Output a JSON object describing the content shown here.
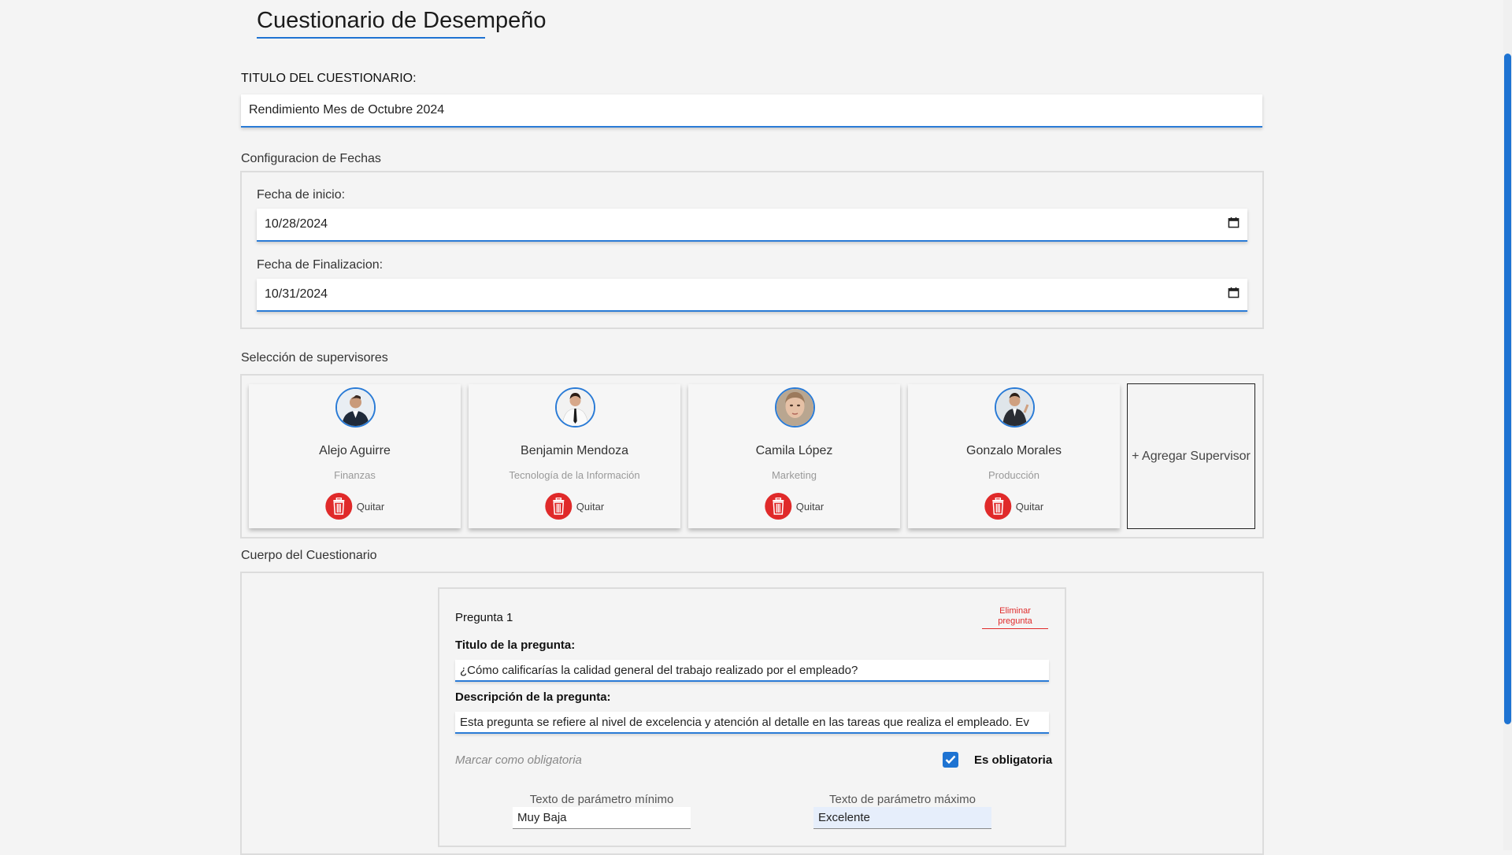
{
  "page": {
    "title": "Cuestionario de Desempeño"
  },
  "title_section": {
    "label": "TITULO DEL CUESTIONARIO:",
    "value": "Rendimiento Mes de Octubre 2024"
  },
  "dates": {
    "section_label": "Configuracion de Fechas",
    "start_label": "Fecha de inicio:",
    "start_value": "10/28/2024",
    "end_label": "Fecha de Finalizacion:",
    "end_value": "10/31/2024"
  },
  "supervisors": {
    "section_label": "Selección de supervisores",
    "remove_label": "Quitar",
    "add_label": "+ Agregar Supervisor",
    "items": [
      {
        "name": "Alejo Aguirre",
        "department": "Finanzas"
      },
      {
        "name": "Benjamin Mendoza",
        "department": "Tecnología de la Información"
      },
      {
        "name": "Camila López",
        "department": "Marketing"
      },
      {
        "name": "Gonzalo Morales",
        "department": "Producción"
      }
    ]
  },
  "questionnaire": {
    "section_label": "Cuerpo del Cuestionario",
    "question": {
      "number_label": "Pregunta 1",
      "delete_label": "Eliminar pregunta",
      "title_label": "Titulo de la pregunta:",
      "title_value": "¿Cómo calificarías la calidad general del trabajo realizado por el empleado?",
      "description_label": "Descripción de la pregunta:",
      "description_value": "Esta pregunta se refiere al nivel de excelencia y atención al detalle en las tareas que realiza el empleado. Ev",
      "mandatory_hint": "Marcar como obligatoria",
      "mandatory_label": "Es obligatoria",
      "mandatory_checked": true,
      "min_param_label": "Texto de parámetro mínimo",
      "min_param_value": "Muy Baja",
      "max_param_label": "Texto de parámetro máximo",
      "max_param_value": "Excelente"
    }
  },
  "colors": {
    "accent": "#1e73d2",
    "danger": "#e02a2a",
    "background": "#f4f4f4"
  }
}
